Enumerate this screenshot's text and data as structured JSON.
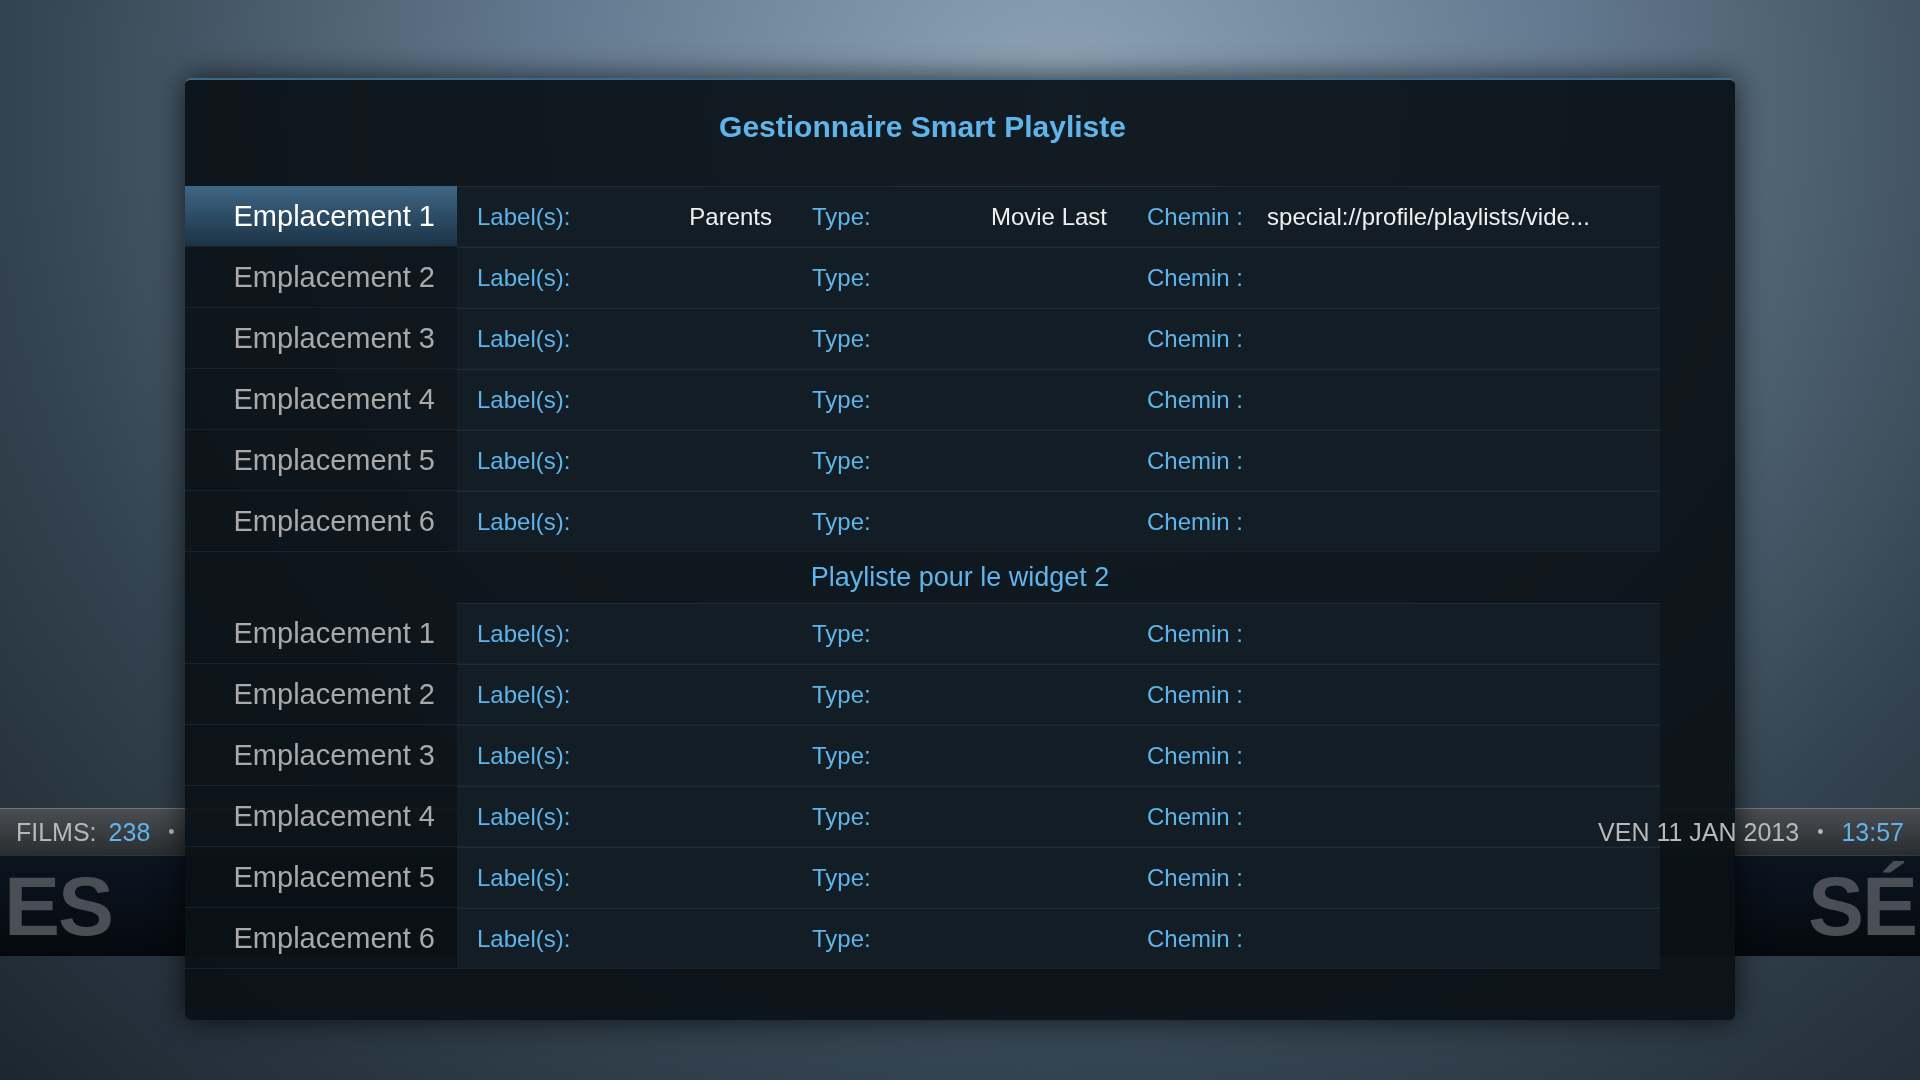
{
  "status_bar": {
    "films_label": "FILMS:",
    "films_count": "238",
    "left_separator": "•",
    "date": "VEN 11 JAN 2013",
    "right_separator": "•",
    "time": "13:57"
  },
  "home_menu": {
    "left_item": "ES",
    "right_item": "SÉ"
  },
  "dialog": {
    "title": "Gestionnaire Smart Playliste",
    "sections": [
      {
        "slots": [
          {
            "name": "Emplacement 1",
            "selected": true,
            "label_caption": "Label(s):",
            "label_value": "Parents",
            "type_caption": "Type:",
            "type_value": "Movie Last",
            "path_caption": "Chemin :",
            "path_value": "special://profile/playlists/vide..."
          },
          {
            "name": "Emplacement 2",
            "selected": false,
            "label_caption": "Label(s):",
            "type_caption": "Type:",
            "path_caption": "Chemin :"
          },
          {
            "name": "Emplacement 3",
            "selected": false,
            "label_caption": "Label(s):",
            "type_caption": "Type:",
            "path_caption": "Chemin :"
          },
          {
            "name": "Emplacement 4",
            "selected": false,
            "label_caption": "Label(s):",
            "type_caption": "Type:",
            "path_caption": "Chemin :"
          },
          {
            "name": "Emplacement 5",
            "selected": false,
            "label_caption": "Label(s):",
            "type_caption": "Type:",
            "path_caption": "Chemin :"
          },
          {
            "name": "Emplacement 6",
            "selected": false,
            "label_caption": "Label(s):",
            "type_caption": "Type:",
            "path_caption": "Chemin :"
          }
        ]
      },
      {
        "heading": "Playliste pour le widget 2",
        "slots": [
          {
            "name": "Emplacement 1",
            "selected": false,
            "label_caption": "Label(s):",
            "type_caption": "Type:",
            "path_caption": "Chemin :"
          },
          {
            "name": "Emplacement 2",
            "selected": false,
            "label_caption": "Label(s):",
            "type_caption": "Type:",
            "path_caption": "Chemin :"
          },
          {
            "name": "Emplacement 3",
            "selected": false,
            "label_caption": "Label(s):",
            "type_caption": "Type:",
            "path_caption": "Chemin :"
          },
          {
            "name": "Emplacement 4",
            "selected": false,
            "label_caption": "Label(s):",
            "type_caption": "Type:",
            "path_caption": "Chemin :"
          },
          {
            "name": "Emplacement 5",
            "selected": false,
            "label_caption": "Label(s):",
            "type_caption": "Type:",
            "path_caption": "Chemin :"
          },
          {
            "name": "Emplacement 6",
            "selected": false,
            "label_caption": "Label(s):",
            "type_caption": "Type:",
            "path_caption": "Chemin :"
          }
        ]
      }
    ]
  }
}
